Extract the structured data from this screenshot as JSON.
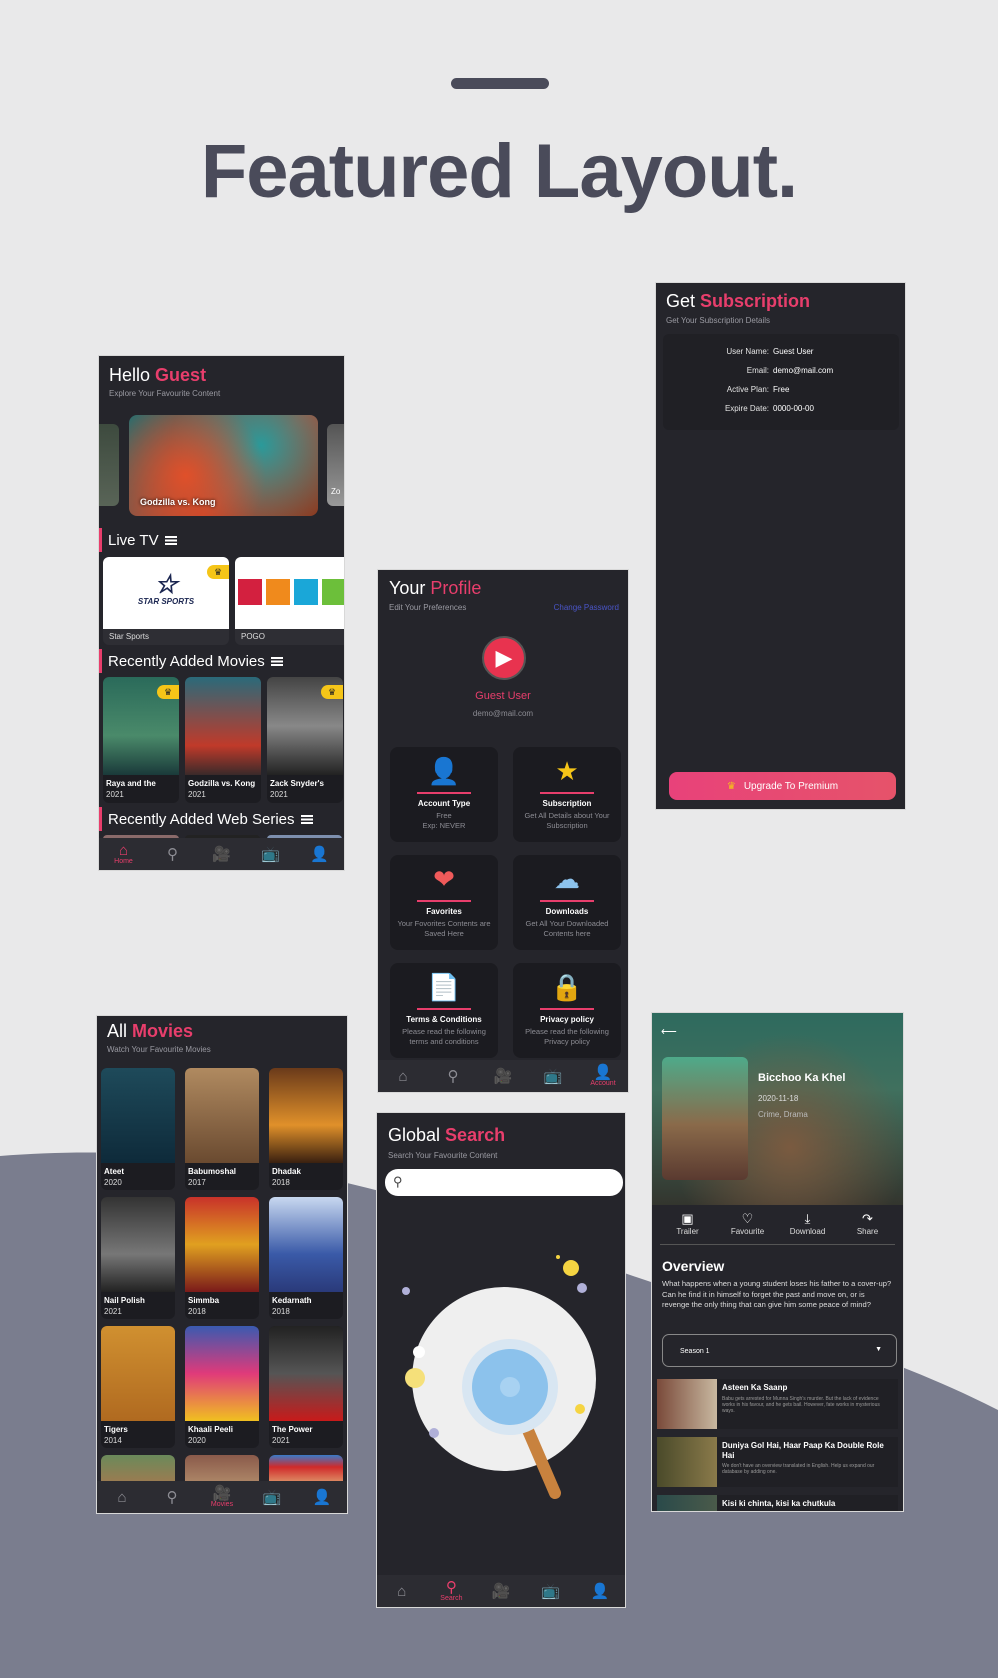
{
  "page": {
    "title": "Featured Layout.",
    "colors": {
      "accent": "#e83e6c",
      "panel_bg": "#25252b",
      "title": "#4a4b5a",
      "link": "#4a55c8"
    }
  },
  "nav": {
    "items": [
      {
        "icon": "home-icon",
        "label": "Home"
      },
      {
        "icon": "search-icon",
        "label": "Search"
      },
      {
        "icon": "movie-camera-icon",
        "label": "Movies"
      },
      {
        "icon": "tv-icon",
        "label": "Live TV"
      },
      {
        "icon": "account-icon",
        "label": "Account"
      }
    ]
  },
  "home": {
    "title_prefix": "Hello",
    "title_accent": "Guest",
    "subtitle": "Explore Your Favourite Content",
    "banner": {
      "title": "Godzilla vs. Kong",
      "next_peek": "Zo"
    },
    "live_tv": {
      "header": "Live TV",
      "channels": [
        {
          "name": "Star Sports",
          "logo": "STAR SPORTS",
          "premium": true
        },
        {
          "name": "POGO",
          "logo": "POGO",
          "premium": false
        }
      ]
    },
    "recent_movies": {
      "header": "Recently Added Movies",
      "items": [
        {
          "title": "Raya and the",
          "year": "2021",
          "premium": true
        },
        {
          "title": "Godzilla vs. Kong",
          "year": "2021",
          "premium": false
        },
        {
          "title": "Zack Snyder's",
          "year": "2021",
          "premium": true
        }
      ]
    },
    "recent_series": {
      "header": "Recently Added Web Series"
    },
    "active_nav": "Home"
  },
  "subscription": {
    "title_prefix": "Get",
    "title_accent": "Subscription",
    "subtitle": "Get Your Subscription Details",
    "rows": [
      {
        "label": "User Name:",
        "value": "Guest User"
      },
      {
        "label": "Email:",
        "value": "demo@mail.com"
      },
      {
        "label": "Active Plan:",
        "value": "Free"
      },
      {
        "label": "Expire Date:",
        "value": "0000-00-00"
      }
    ],
    "upgrade_button": "Upgrade To Premium"
  },
  "profile": {
    "title_prefix": "Your",
    "title_accent": "Profile",
    "subtitle": "Edit Your Preferences",
    "change_password": "Change Password",
    "user_name": "Guest User",
    "email": "demo@mail.com",
    "cards": [
      {
        "icon": "user-icon",
        "title": "Account Type",
        "desc": "Free\nExp: NEVER"
      },
      {
        "icon": "laurel-star-icon",
        "title": "Subscription",
        "desc": "Get All Details about Your Subscription"
      },
      {
        "icon": "heart-icon",
        "title": "Favorites",
        "desc": "Your Fovorites Contents are Saved Here"
      },
      {
        "icon": "cloud-download-icon",
        "title": "Downloads",
        "desc": "Get All Your Downloaded Contents here"
      },
      {
        "icon": "terms-document-icon",
        "title": "Terms & Conditions",
        "desc": "Please read the following terms and conditions"
      },
      {
        "icon": "privacy-shield-icon",
        "title": "Privacy policy",
        "desc": "Please read the following Privacy policy"
      }
    ],
    "active_nav": "Account"
  },
  "movies": {
    "title_prefix": "All",
    "title_accent": "Movies",
    "subtitle": "Watch Your Favourite Movies",
    "items": [
      {
        "title": "Ateet",
        "year": "2020"
      },
      {
        "title": "Babumoshal",
        "year": "2017"
      },
      {
        "title": "Dhadak",
        "year": "2018"
      },
      {
        "title": "Nail Polish",
        "year": "2021"
      },
      {
        "title": "Simmba",
        "year": "2018"
      },
      {
        "title": "Kedarnath",
        "year": "2018"
      },
      {
        "title": "Tigers",
        "year": "2014"
      },
      {
        "title": "Khaali Peeli",
        "year": "2020"
      },
      {
        "title": "The Power",
        "year": "2021"
      }
    ],
    "active_nav": "Movies"
  },
  "search": {
    "title_prefix": "Global",
    "title_accent": "Search",
    "subtitle": "Search Your Favourite Content",
    "input_value": "",
    "input_placeholder": "",
    "active_nav": "Search"
  },
  "detail": {
    "title": "Bicchoo Ka Khel",
    "date": "2020-11-18",
    "genres": "Crime, Drama",
    "actions": [
      {
        "icon": "trailer-icon",
        "label": "Trailer"
      },
      {
        "icon": "heart-outline-icon",
        "label": "Favourite"
      },
      {
        "icon": "download-icon",
        "label": "Download"
      },
      {
        "icon": "share-icon",
        "label": "Share"
      }
    ],
    "overview_heading": "Overview",
    "overview": "What happens when a young student loses his father to a cover-up? Can he find it in himself to forget the past and move on, or is revenge the only thing that can give him some peace of mind?",
    "season_select": "Season 1",
    "episodes": [
      {
        "title": "Asteen Ka Saanp",
        "desc": "Babu gets arrested for Munna Singh's murder. But the lack of evidence works in his favour, and he gets bail. However, fate works in mysterious ways."
      },
      {
        "title": "Duniya Gol Hai, Haar Paap Ka Double Role Hai",
        "desc": "We don't have an overview translated in English. Help us expand our database by adding one."
      },
      {
        "title": "Kisi ki chinta, kisi ka chutkula",
        "desc": ""
      }
    ]
  }
}
